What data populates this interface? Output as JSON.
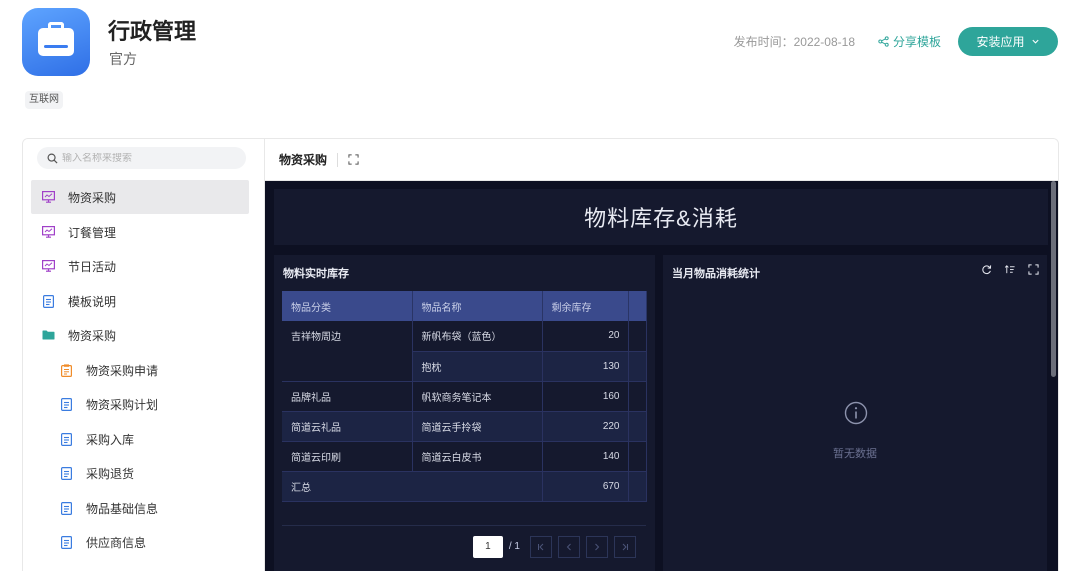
{
  "app": {
    "title": "行政管理",
    "subtitle": "官方",
    "tag": "互联网",
    "publish_time": "发布时间：2022-08-18",
    "share_label": "分享模板",
    "install_label": "安装应用",
    "accent_color": "#2ea59a"
  },
  "sidebar": {
    "search_placeholder": "输入名称来搜索",
    "items": [
      {
        "label": "物资采购",
        "icon": "dashboard-icon",
        "active": true
      },
      {
        "label": "订餐管理",
        "icon": "dashboard-icon"
      },
      {
        "label": "节日活动",
        "icon": "dashboard-icon"
      },
      {
        "label": "模板说明",
        "icon": "document-icon"
      },
      {
        "label": "物资采购",
        "icon": "folder-icon"
      },
      {
        "label": "物资采购申请",
        "icon": "form-icon"
      },
      {
        "label": "物资采购计划",
        "icon": "document-icon"
      },
      {
        "label": "采购入库",
        "icon": "document-icon"
      },
      {
        "label": "采购退货",
        "icon": "document-icon"
      },
      {
        "label": "物品基础信息",
        "icon": "document-icon"
      },
      {
        "label": "供应商信息",
        "icon": "document-icon"
      }
    ]
  },
  "content": {
    "tab_title": "物资采购",
    "dashboard_title": "物料库存&消耗",
    "left_panel": {
      "title": "物料实时库存",
      "columns": [
        "物品分类",
        "物品名称",
        "剩余库存"
      ],
      "rows": [
        [
          "吉祥物周边",
          "新帆布袋（蓝色）",
          "20"
        ],
        [
          "",
          "抱枕",
          "130"
        ],
        [
          "品牌礼品",
          "帆软商务笔记本",
          "160"
        ],
        [
          "简道云礼品",
          "简道云手拎袋",
          "220"
        ],
        [
          "简道云印刷",
          "简道云白皮书",
          "140"
        ],
        [
          "汇总",
          "",
          "670"
        ]
      ],
      "pager": {
        "current": "1",
        "total": "/ 1"
      }
    },
    "right_panel": {
      "title": "当月物品消耗统计",
      "empty_text": "暂无数据"
    }
  }
}
